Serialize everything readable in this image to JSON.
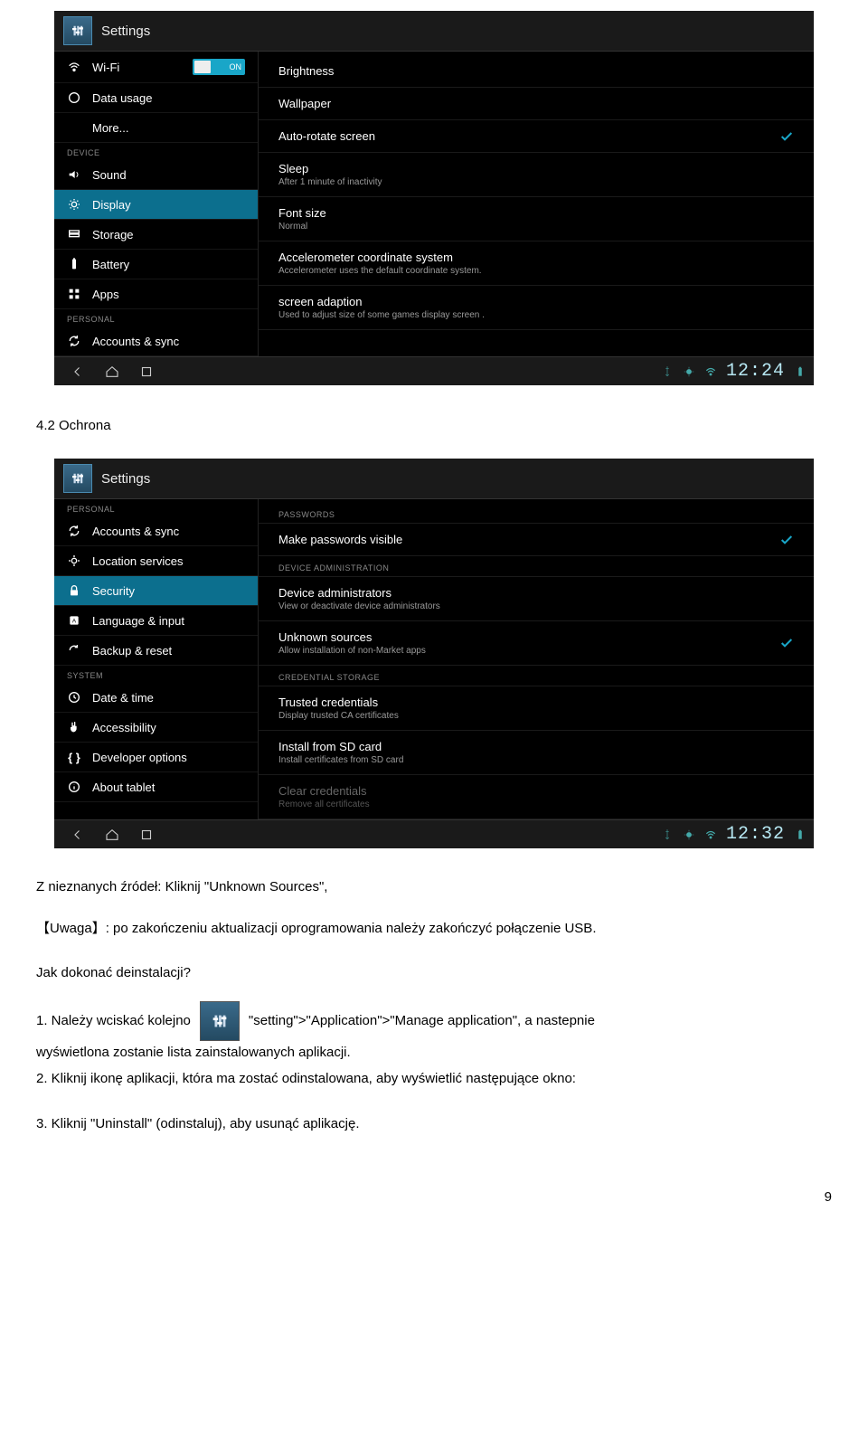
{
  "shot1": {
    "title": "Settings",
    "wifi": {
      "label": "Wi-Fi",
      "toggle": "ON"
    },
    "data_usage": "Data usage",
    "more": "More...",
    "section_device": "DEVICE",
    "sound": "Sound",
    "display": "Display",
    "storage": "Storage",
    "battery": "Battery",
    "apps": "Apps",
    "section_personal": "PERSONAL",
    "accounts_sync": "Accounts & sync",
    "content": {
      "brightness": "Brightness",
      "wallpaper": "Wallpaper",
      "auto_rotate": "Auto-rotate screen",
      "sleep": {
        "label": "Sleep",
        "sub": "After 1 minute of inactivity"
      },
      "font": {
        "label": "Font size",
        "sub": "Normal"
      },
      "accel": {
        "label": "Accelerometer coordinate system",
        "sub": "Accelerometer uses the default coordinate system."
      },
      "adapt": {
        "label": "screen adaption",
        "sub": "Used to adjust size of some games display screen ."
      }
    },
    "clock": "12:24"
  },
  "doc_section_title": "4.2   Ochrona",
  "shot2": {
    "title": "Settings",
    "section_personal": "PERSONAL",
    "accounts_sync": "Accounts & sync",
    "location": "Location services",
    "security": "Security",
    "lang": "Language & input",
    "backup": "Backup & reset",
    "section_system": "SYSTEM",
    "datetime": "Date & time",
    "access": "Accessibility",
    "dev": "Developer options",
    "about": "About tablet",
    "content": {
      "sec_passwords": "PASSWORDS",
      "make_visible": "Make passwords visible",
      "sec_admin": "DEVICE ADMINISTRATION",
      "dev_admin": {
        "label": "Device administrators",
        "sub": "View or deactivate device administrators"
      },
      "unknown": {
        "label": "Unknown sources",
        "sub": "Allow installation of non-Market apps"
      },
      "sec_cred": "CREDENTIAL STORAGE",
      "trusted": {
        "label": "Trusted credentials",
        "sub": "Display trusted CA certificates"
      },
      "install_sd": {
        "label": "Install from SD card",
        "sub": "Install certificates from SD card"
      },
      "clear": {
        "label": "Clear credentials",
        "sub": "Remove all certificates"
      }
    },
    "clock": "12:32"
  },
  "doc": {
    "p_unknown": "Z nieznanych źródeł: Kliknij \"Unknown Sources\",",
    "p_uwaga": "【Uwaga】: po zakończeniu    aktualizacji oprogramowania należy zakończyć połączenie USB.",
    "p_deinst": "Jak dokonać deinstalacji?",
    "p_step1_a": "1. Należy wciskać kolejno",
    "p_step1_b": "\"setting\">\"Application\">\"Manage application\", a nastepnie",
    "p_step1_c": "wyświetlona zostanie lista zainstalowanych aplikacji.",
    "p_step2": "2. Kliknij ikonę aplikacji, która ma zostać odinstalowana, aby wyświetlić następujące okno:",
    "p_step3": "3. Kliknij \"Uninstall\" (odinstaluj), aby usunąć aplikację."
  },
  "page_num": "9",
  "chart_data": {
    "type": "table",
    "note": "No chart present; screenshots depict Android Settings UI (Display and Security panes)."
  }
}
